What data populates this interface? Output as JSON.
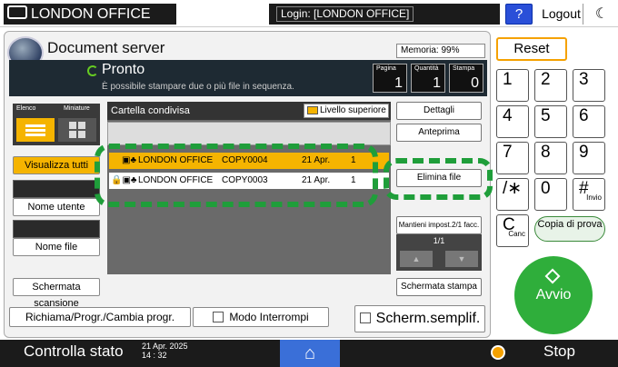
{
  "topbar": {
    "user": "LONDON OFFICE",
    "login": "Login: [LONDON OFFICE]",
    "help": "?",
    "logout": "Logout",
    "mode_icon": "moon-icon"
  },
  "app": {
    "title": "Document server",
    "memory": "Memoria:  99%"
  },
  "status": {
    "state": "Pronto",
    "message": "È possibile stampare due o più file in sequenza.",
    "counters": [
      {
        "label": "Pagina",
        "value": "1"
      },
      {
        "label": "Quantità",
        "value": "1"
      },
      {
        "label": "Stampa",
        "value": "0"
      }
    ]
  },
  "view": {
    "list_label": "Elenco",
    "thumb_label": "Miniature"
  },
  "left_buttons": {
    "show_all": "Visualizza tutti",
    "user_name": "Nome utente",
    "file_name": "Nome file",
    "scan_screen": "Schermata scansione"
  },
  "folder": {
    "name": "Cartella condivisa",
    "up_level": "Livello superiore"
  },
  "files": [
    {
      "owner": "LONDON OFFICE",
      "name": "COPY0004",
      "date": "21 Apr.",
      "pages": "1",
      "selected": true
    },
    {
      "owner": "LONDON OFFICE",
      "name": "COPY0003",
      "date": "21 Apr.",
      "pages": "1",
      "selected": false
    }
  ],
  "right_buttons": {
    "details": "Dettagli",
    "preview": "Anteprima",
    "delete": "Elimina file",
    "keep_settings": "Mantieni impost.2/1 facc.",
    "page": "1/1",
    "print_screen": "Schermata stampa"
  },
  "bottom": {
    "recall": "Richiama/Progr./Cambia progr.",
    "interrupt": "Modo Interrompi",
    "simple": "Scherm.semplif."
  },
  "keypad": {
    "reset": "Reset",
    "keys": [
      "1",
      "2",
      "3",
      "4",
      "5",
      "6",
      "7",
      "8",
      "9",
      "/∗",
      "0",
      "#"
    ],
    "hash_sub": "Invio",
    "clear": "C",
    "clear_sub": "Canc",
    "proof": "Copia di prova",
    "start": "Avvio"
  },
  "footer": {
    "check_status": "Controlla stato",
    "date": "21 Apr. 2025",
    "time": "14 : 32",
    "stop": "Stop"
  },
  "colors": {
    "highlight": "#1f9e3a",
    "selected_row": "#f5b400",
    "start": "#2fae3b"
  }
}
